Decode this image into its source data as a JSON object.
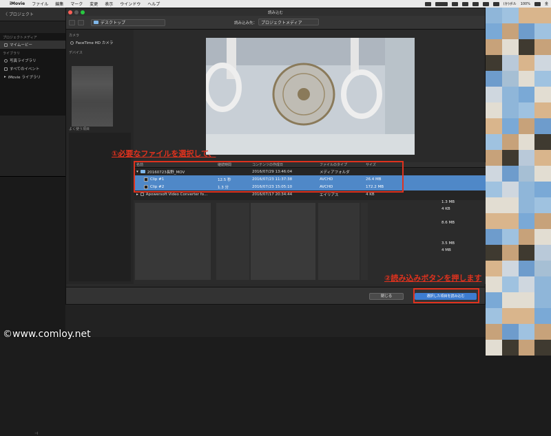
{
  "menubar": {
    "app_name": "iMovie",
    "items": [
      "ファイル",
      "編集",
      "マーク",
      "変更",
      "表示",
      "ウインドウ",
      "ヘルプ"
    ],
    "clock": "(か)ボル",
    "battery": "100%",
    "right_label": "金"
  },
  "imovie": {
    "back_label": "〈 プロジェクト",
    "library_header": "プロジェクトメディア",
    "my_movie": "マイムービー",
    "library_section": "ライブラリ",
    "photos_library": "写真ライブラリ",
    "all_events": "すべてのイベント",
    "imovie_library": "iMovie ライブラリ"
  },
  "dialog": {
    "title": "読み込む",
    "location": "デスクトップ",
    "import_to_label": "読み込み先：",
    "import_to_value": "プロジェクトメディア",
    "sidebar": {
      "camera_section": "カメラ",
      "facetime": "FaceTime HD カメラ",
      "devices_section": "デバイス",
      "favorites_section": "よく使う項目"
    },
    "columns": [
      "名前",
      "継続時間",
      "コンテンツの作成日",
      "ファイルのタイプ",
      "サイズ"
    ],
    "rows": [
      {
        "name": "20160723長野_MOV",
        "duration": "",
        "date": "2016/07/29 13:46:04",
        "type": "メディアフォルダ",
        "size": ""
      },
      {
        "name": "Clip #1",
        "duration": "12.5 秒",
        "date": "2016/07/23 11:37:38",
        "type": "AVCHD",
        "size": "26.4 MB"
      },
      {
        "name": "Clip #2",
        "duration": "1.3 分",
        "date": "2016/07/23 15:05:10",
        "type": "AVCHD",
        "size": "172.2 MB"
      },
      {
        "name": "Apowersoft Video Converter fo...",
        "duration": "",
        "date": "2016/07/17 20:34:44",
        "type": "エイリアス",
        "size": "4 KB"
      }
    ],
    "other_sizes": [
      "1.3 MB",
      "4 KB",
      "",
      "8.6 MB",
      "",
      "",
      "3.5 MB",
      "4 MB"
    ],
    "close_label": "閉じる",
    "import_label": "選択した項目を読み込む"
  },
  "annotations": {
    "step1": "①必要なファイルを選択して、",
    "step2": "②読み込みボタンを押します",
    "watermark": "©www.comloy.net"
  },
  "colors": {
    "selection": "#4f88c8",
    "annotation": "#e0321e",
    "import_button": "#3d7cd0"
  }
}
